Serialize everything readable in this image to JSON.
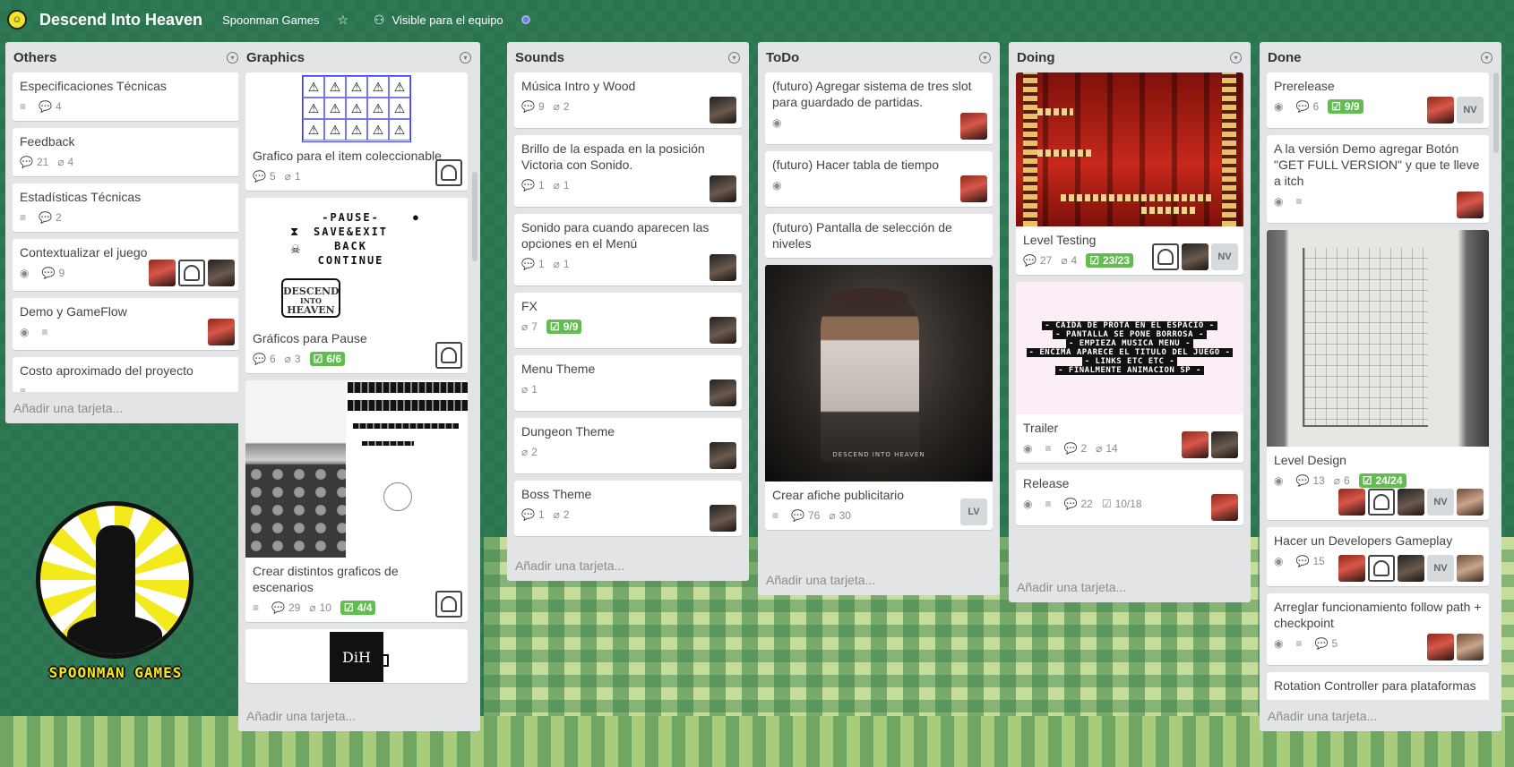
{
  "header": {
    "title": "Descend Into Heaven",
    "team": "Spoonman Games",
    "visibility": "Visible para el equipo"
  },
  "add_card_label": "Añadir una tarjeta...",
  "logo": {
    "text": "SPOONMAN GAMES"
  },
  "lists": {
    "others": {
      "title": "Others",
      "cards": [
        {
          "title": "Especificaciones Técnicas",
          "comments": "4"
        },
        {
          "title": "Feedback",
          "comments": "21",
          "attachments": "4"
        },
        {
          "title": "Estadísticas Técnicas",
          "comments": "2"
        },
        {
          "title": "Contextualizar el juego",
          "comments": "9"
        },
        {
          "title": "Demo y GameFlow"
        },
        {
          "title": "Costo aproximado del proyecto"
        }
      ]
    },
    "graphics": {
      "title": "Graphics",
      "cards": [
        {
          "title": "Grafico para el item coleccionable",
          "comments": "5",
          "attachments": "1"
        },
        {
          "title": "Gráficos para Pause",
          "comments": "6",
          "attachments": "3",
          "checklist": "6/6",
          "cover_text": [
            "-PAUSE-",
            "SAVE&EXIT",
            "BACK",
            "CONTINUE"
          ],
          "cover_logo": [
            "DESCEND",
            "INTO",
            "HEAVEN"
          ]
        },
        {
          "title": "Crear distintos graficos de escenarios",
          "comments": "29",
          "attachments": "10",
          "checklist": "4/4"
        },
        {
          "title": "",
          "cover_text": "DiH"
        }
      ]
    },
    "sounds": {
      "title": "Sounds",
      "cards": [
        {
          "title": "Música Intro y Wood",
          "comments": "9",
          "attachments": "2"
        },
        {
          "title": "Brillo de la espada en la posición Victoria con Sonido.",
          "comments": "1",
          "attachments": "1"
        },
        {
          "title": "Sonido para cuando aparecen las opciones en el Menú",
          "comments": "1",
          "attachments": "1"
        },
        {
          "title": "FX",
          "attachments": "7",
          "checklist": "9/9"
        },
        {
          "title": "Menu Theme",
          "attachments": "1"
        },
        {
          "title": "Dungeon Theme",
          "attachments": "2"
        },
        {
          "title": "Boss Theme",
          "comments": "1",
          "attachments": "2"
        }
      ]
    },
    "todo": {
      "title": "ToDo",
      "cards": [
        {
          "title": "(futuro) Agregar sistema de tres slot para guardado de partidas."
        },
        {
          "title": "(futuro) Hacer tabla de tiempo"
        },
        {
          "title": "(futuro) Pantalla de selección de niveles"
        },
        {
          "title": "Crear afiche publicitario",
          "comments": "76",
          "attachments": "30",
          "member": "LV",
          "cover_caption": "DESCEND INTO HEAVEN"
        }
      ]
    },
    "doing": {
      "title": "Doing",
      "cards": [
        {
          "title": "Level Testing",
          "comments": "27",
          "attachments": "4",
          "checklist": "23/23",
          "member": "NV"
        },
        {
          "title": "Trailer",
          "comments": "2",
          "attachments": "14",
          "cover_lines": [
            "- CAIDA DE PROTA EN EL ESPACIO -",
            "- PANTALLA SE PONE BORROSA -",
            "- EMPIEZA MUSICA MENU -",
            "- ENCIMA APARECE EL TITULO DEL JUEGO -",
            "- LINKS ETC ETC -",
            "- FINALMENTE ANIMACION SP -"
          ]
        },
        {
          "title": "Release",
          "comments": "22",
          "checklist": "10/18"
        }
      ]
    },
    "done": {
      "title": "Done",
      "cards": [
        {
          "title": "Prerelease",
          "comments": "6",
          "checklist": "9/9",
          "member": "NV"
        },
        {
          "title": "A la versión Demo agregar Botón \"GET FULL VERSION\" y que te lleve a itch"
        },
        {
          "title": "Level Design",
          "comments": "13",
          "attachments": "6",
          "checklist": "24/24",
          "member": "NV"
        },
        {
          "title": "Hacer un Developers Gameplay",
          "comments": "15",
          "member": "NV"
        },
        {
          "title": "Arreglar funcionamiento follow path + checkpoint",
          "comments": "5"
        },
        {
          "title": "Rotation Controller para plataformas"
        }
      ]
    }
  },
  "colors": {
    "checklist_green": "#61bd4f",
    "list_bg": "#e2e4e6",
    "board_bg": "#2f7a54"
  }
}
